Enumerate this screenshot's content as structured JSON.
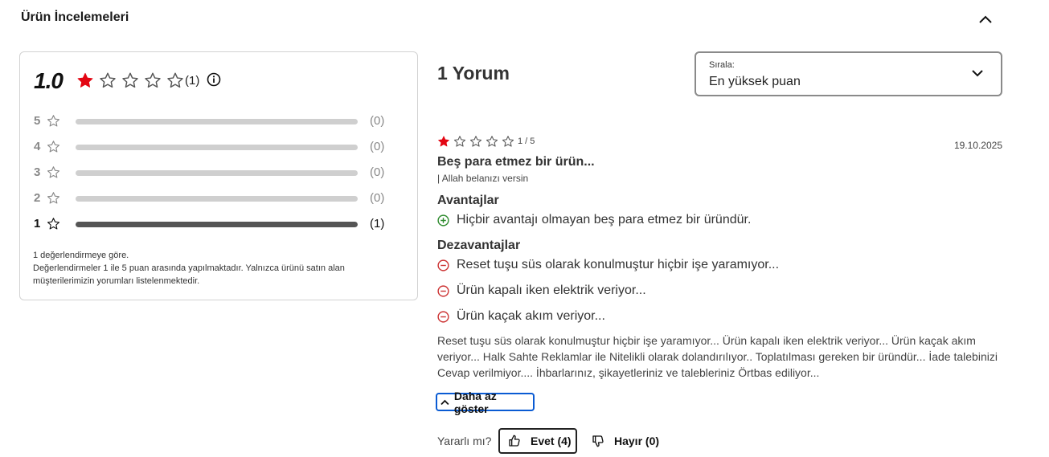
{
  "section": {
    "title": "Ürün İncelemeleri"
  },
  "summary": {
    "average": "1.0",
    "average_stars": 1,
    "count_label": "(1)",
    "distribution": [
      {
        "stars": "5",
        "count": "(0)",
        "fraction": 0
      },
      {
        "stars": "4",
        "count": "(0)",
        "fraction": 0
      },
      {
        "stars": "3",
        "count": "(0)",
        "fraction": 0
      },
      {
        "stars": "2",
        "count": "(0)",
        "fraction": 0
      },
      {
        "stars": "1",
        "count": "(1)",
        "fraction": 1
      }
    ],
    "note_line1": "1 değerlendirmeye göre.",
    "note_line2": "Değerlendirmeler 1 ile 5 puan arasında yapılmaktadır. Yalnızca ürünü satın alan müşterilerimizin yorumları listelenmektedir."
  },
  "reviews_header": {
    "count_label": "1 Yorum"
  },
  "sort": {
    "label": "Sırala:",
    "value": "En yüksek puan"
  },
  "review": {
    "stars": 1,
    "score": "1 / 5",
    "date": "19.10.2025",
    "title": "Beş para etmez bir ürün...",
    "author": "| Allah belanızı versin",
    "pros_heading": "Avantajlar",
    "pros": [
      "Hiçbir avantajı olmayan beş para etmez bir üründür."
    ],
    "cons_heading": "Dezavantajlar",
    "cons": [
      "Reset tuşu süs olarak konulmuştur hiçbir işe yaramıyor...",
      "Ürün kapalı iken elektrik veriyor...",
      "Ürün kaçak akım veriyor..."
    ],
    "body": "Reset tuşu süs olarak konulmuştur hiçbir işe yaramıyor... Ürün kapalı iken elektrik veriyor... Ürün kaçak akım veriyor... Halk Sahte Reklamlar ile Nitelikli olarak dolandırılıyor.. Toplatılması gereken bir üründür... İade talebinizi Cevap verilmiyor.... İhbarlarınız, şikayetleriniz ve talebleriniz Örtbas ediliyor...",
    "show_less_label": "Daha az göster",
    "helpful_question": "Yararlı mı?",
    "yes_label": "Evet (4)",
    "no_label": "Hayır (0)"
  },
  "colors": {
    "star_filled": "#e30613",
    "pros_icon": "#2e8b2e",
    "cons_icon": "#cc3333",
    "focus": "#0a5bd3"
  }
}
